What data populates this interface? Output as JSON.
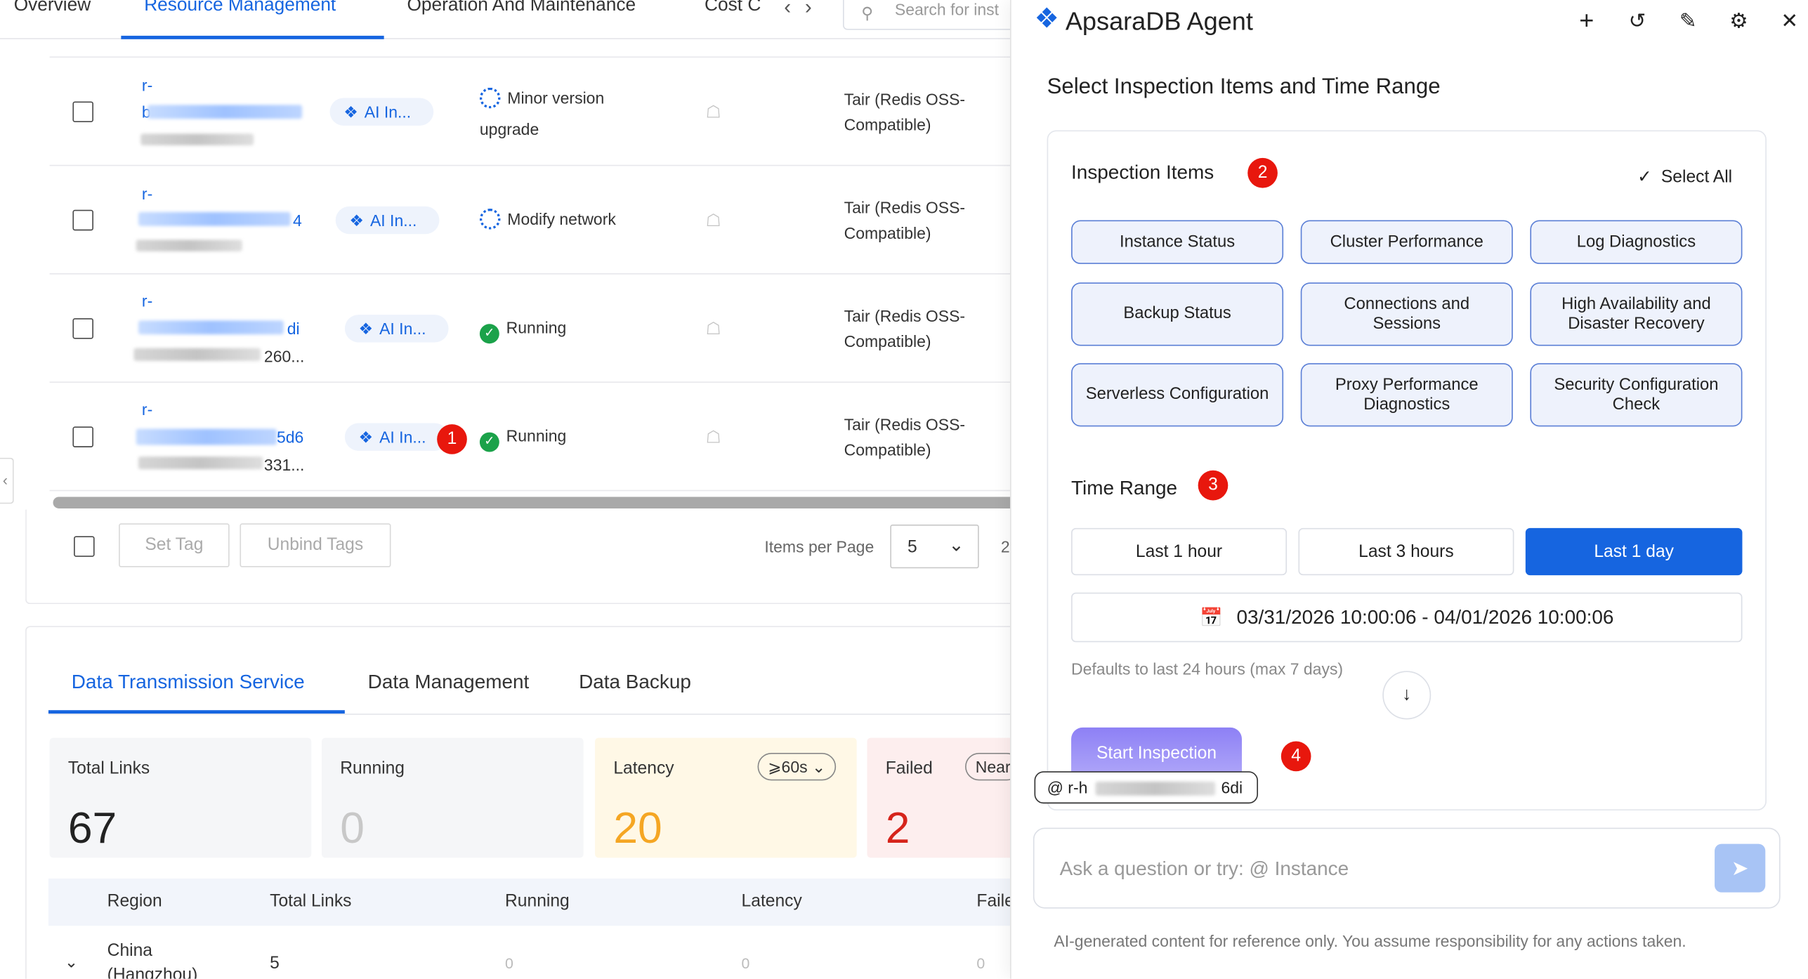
{
  "nav": {
    "tabs": [
      "Overview",
      "Resource Management",
      "Operation And Maintenance",
      "Cost C"
    ],
    "active_tab": "Resource Management",
    "search_placeholder": "Search for inst"
  },
  "instances": [
    {
      "id_prefix": "r-",
      "id_suffix": "",
      "id2_suffix": "",
      "ai_tag": "AI In...",
      "status": "Minor version upgrade",
      "status_type": "in-progress",
      "engine": "Tair (Redis OSS-Compatible)"
    },
    {
      "id_prefix": "r-",
      "id_suffix": "4",
      "id2_suffix": "",
      "ai_tag": "AI In...",
      "status": "Modify network",
      "status_type": "in-progress",
      "engine": "Tair (Redis OSS-Compatible)"
    },
    {
      "id_prefix": "r-",
      "id_suffix": "di",
      "id2_suffix": "260...",
      "ai_tag": "AI In...",
      "status": "Running",
      "status_type": "running",
      "engine": "Tair (Redis OSS-Compatible)"
    },
    {
      "id_prefix": "r-",
      "id_suffix": "5d6",
      "id2_suffix": "331...",
      "ai_tag": "AI In...",
      "status": "Running",
      "status_type": "running",
      "engine": "Tair (Redis OSS-Compatible)"
    }
  ],
  "table_footer": {
    "set_tag": "Set Tag",
    "unbind_tags": "Unbind Tags",
    "items_per_page_label": "Items per Page",
    "items_per_page": "5",
    "page_fragment": "2"
  },
  "dts": {
    "tabs": [
      "Data Transmission Service",
      "Data Management",
      "Data Backup"
    ],
    "cards": [
      {
        "label": "Total Links",
        "value": "67",
        "color": "#222222",
        "bg": "#f5f6f8"
      },
      {
        "label": "Running",
        "value": "0",
        "color": "#c8c8c8",
        "bg": "#f5f6f8"
      },
      {
        "label": "Latency",
        "value": "20",
        "color": "#f5a623",
        "bg": "#fff8e6",
        "select": "⩾60s"
      },
      {
        "label": "Failed",
        "value": "2",
        "color": "#d6241b",
        "bg": "#fdeeee",
        "select": "Near"
      }
    ],
    "columns": [
      "Region",
      "Total Links",
      "Running",
      "Latency",
      "Faile"
    ],
    "rows": [
      {
        "region_line1": "China",
        "region_line2": "(Hangzhou)",
        "total_links": "5",
        "running": "0",
        "latency": "0",
        "failed": "0"
      }
    ]
  },
  "agent": {
    "title": "ApsaraDB Agent",
    "header_icons": [
      "plus-icon",
      "history-icon",
      "edit-icon",
      "settings-icon",
      "close-icon"
    ],
    "panel_title": "Select Inspection Items and Time Range",
    "inspection_label": "Inspection Items",
    "select_all": "Select All",
    "items": [
      "Instance Status",
      "Cluster Performance",
      "Log Diagnostics",
      "Backup Status",
      "Connections and Sessions",
      "High Availability and Disaster Recovery",
      "Serverless Configuration",
      "Proxy Performance Diagnostics",
      "Security Configuration Check"
    ],
    "time_range_label": "Time Range",
    "time_options": [
      "Last 1 hour",
      "Last 3 hours",
      "Last 1 day"
    ],
    "selected_time": "Last 1 day",
    "date_range": "03/31/2026 10:00:06 - 04/01/2026 10:00:06",
    "hint": "Defaults to last 24 hours (max 7 days)",
    "start_button": "Start Inspection",
    "mention_prefix": "@ r-h",
    "mention_suffix": "6di",
    "chat_placeholder": "Ask a question or try: @ Instance",
    "disclaimer": "AI-generated content for reference only. You assume responsibility for any actions taken."
  },
  "annotations": [
    "1",
    "2",
    "3",
    "4"
  ],
  "colors": {
    "accent": "#1665e0",
    "badge": "#e8170d",
    "running": "#1ba24a"
  }
}
